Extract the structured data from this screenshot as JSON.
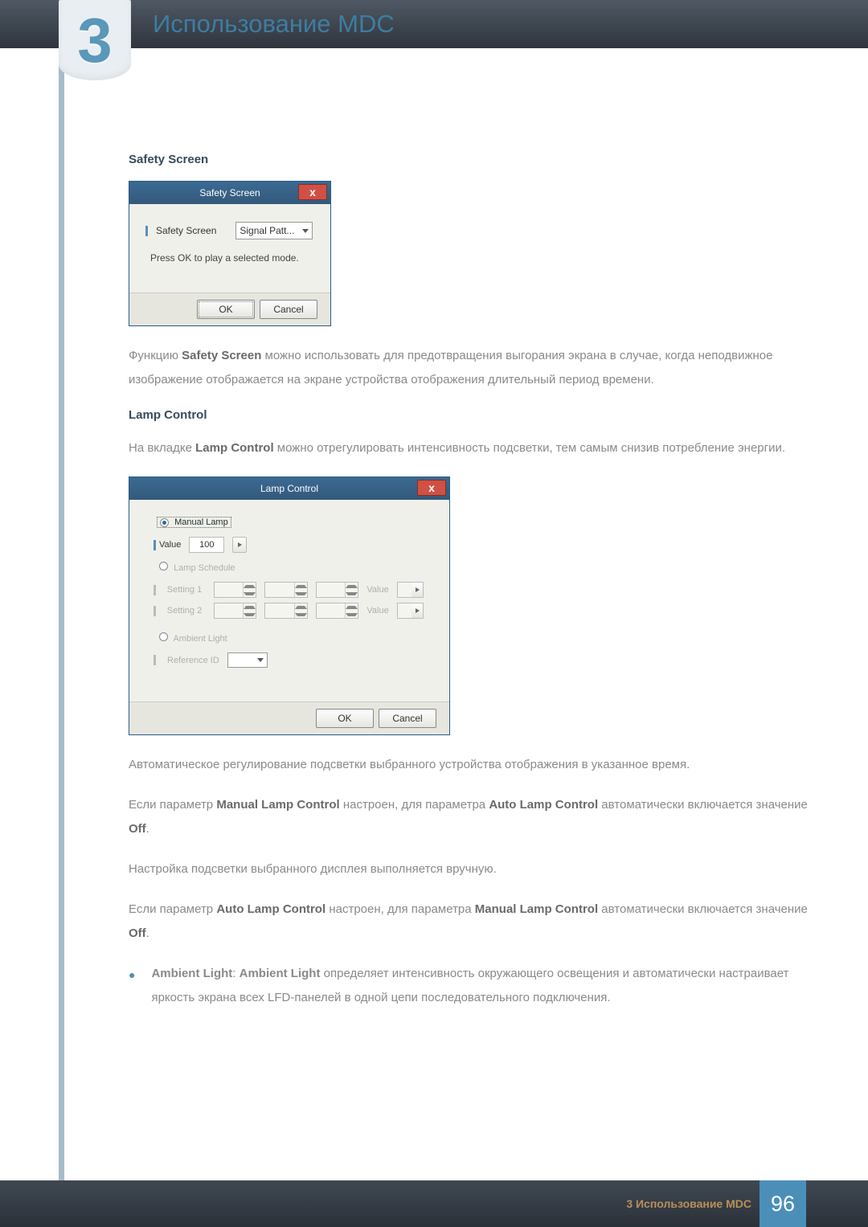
{
  "header": {
    "chapter_number": "3",
    "chapter_title": "Использование MDC"
  },
  "sections": {
    "safety_screen_heading": "Safety Screen",
    "lamp_control_heading": "Lamp Control"
  },
  "safety_dialog": {
    "title": "Safety Screen",
    "field_label": "Safety Screen",
    "dropdown_value": "Signal Patt...",
    "hint": "Press OK to play a selected mode.",
    "ok": "OK",
    "cancel": "Cancel"
  },
  "safety_paragraph": {
    "p1_a": "Функцию ",
    "p1_b": "Safety Screen",
    "p1_c": " можно использовать для предотвращения выгорания экрана в случае, когда неподвижное изображение отображается на экране устройства отображения длительный период времени."
  },
  "lamp_paragraph_intro": {
    "a": "На вкладке ",
    "b": "Lamp Control",
    "c": " можно отрегулировать интенсивность подсветки, тем самым снизив потребление энергии."
  },
  "lamp_dialog": {
    "title": "Lamp Control",
    "manual_label": "Manual Lamp",
    "value_label": "Value",
    "value_num": "100",
    "schedule_label": "Lamp Schedule",
    "setting1": "Setting 1",
    "setting2": "Setting 2",
    "value_text": "Value",
    "ambient_label": "Ambient Light",
    "reference_label": "Reference ID",
    "ok": "OK",
    "cancel": "Cancel"
  },
  "paragraphs": {
    "auto_adjust": "Автоматическое регулирование подсветки выбранного устройства отображения в указанное время.",
    "manual_a": "Если параметр ",
    "manual_b": "Manual Lamp Control",
    "manual_c": " настроен, для параметра ",
    "manual_d": "Auto Lamp Control",
    "manual_e": " автоматически включается значение ",
    "manual_f": "Off",
    "manual_g": ".",
    "manual_setting": "Настройка подсветки выбранного дисплея выполняется вручную.",
    "auto_a": "Если параметр ",
    "auto_b": "Auto Lamp Control",
    "auto_c": " настроен, для параметра ",
    "auto_d": "Manual Lamp Control",
    "auto_e": " автоматически включается значение ",
    "auto_f": "Off",
    "auto_g": ".",
    "ambient_a": "Ambient Light",
    "ambient_sep": ": ",
    "ambient_b": "Ambient Light",
    "ambient_c": " определяет интенсивность окружающего освещения и автоматически настраивает яркость экрана всех LFD-панелей в одной цепи последовательного подключения."
  },
  "footer": {
    "text": "3 Использование MDC",
    "page": "96"
  }
}
